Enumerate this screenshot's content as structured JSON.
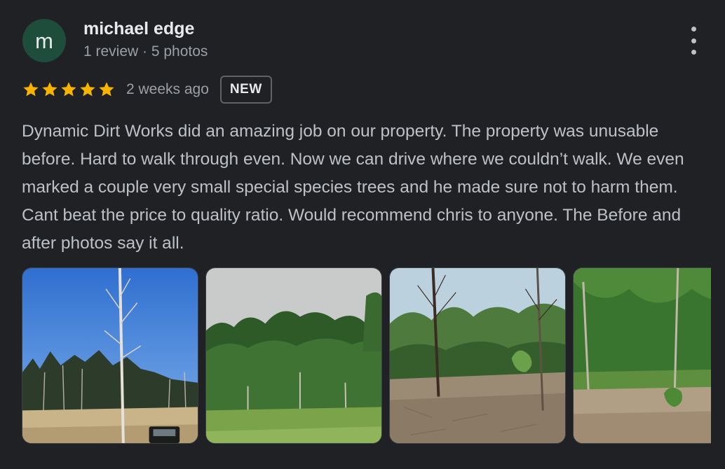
{
  "review": {
    "avatar_initial": "m",
    "author_name": "michael edge",
    "author_meta": "1 review · 5 photos",
    "rating": 5,
    "rating_max": 5,
    "time_ago": "2 weeks ago",
    "badge": "NEW",
    "text": "Dynamic Dirt Works did an amazing job on our property. The property was unusable before. Hard to walk through even. Now we can drive where we couldn’t walk. We even marked a couple very small special species trees and he made sure not to harm them. Cant beat the price to quality ratio. Would recommend chris to anyone. The Before and after photos say it all."
  },
  "colors": {
    "background": "#202124",
    "star": "#f6b400",
    "avatar_bg": "#1e4d3c",
    "secondary_text": "#9aa0a6"
  },
  "icons": {
    "menu": "more-vertical-icon",
    "star": "star-icon"
  }
}
